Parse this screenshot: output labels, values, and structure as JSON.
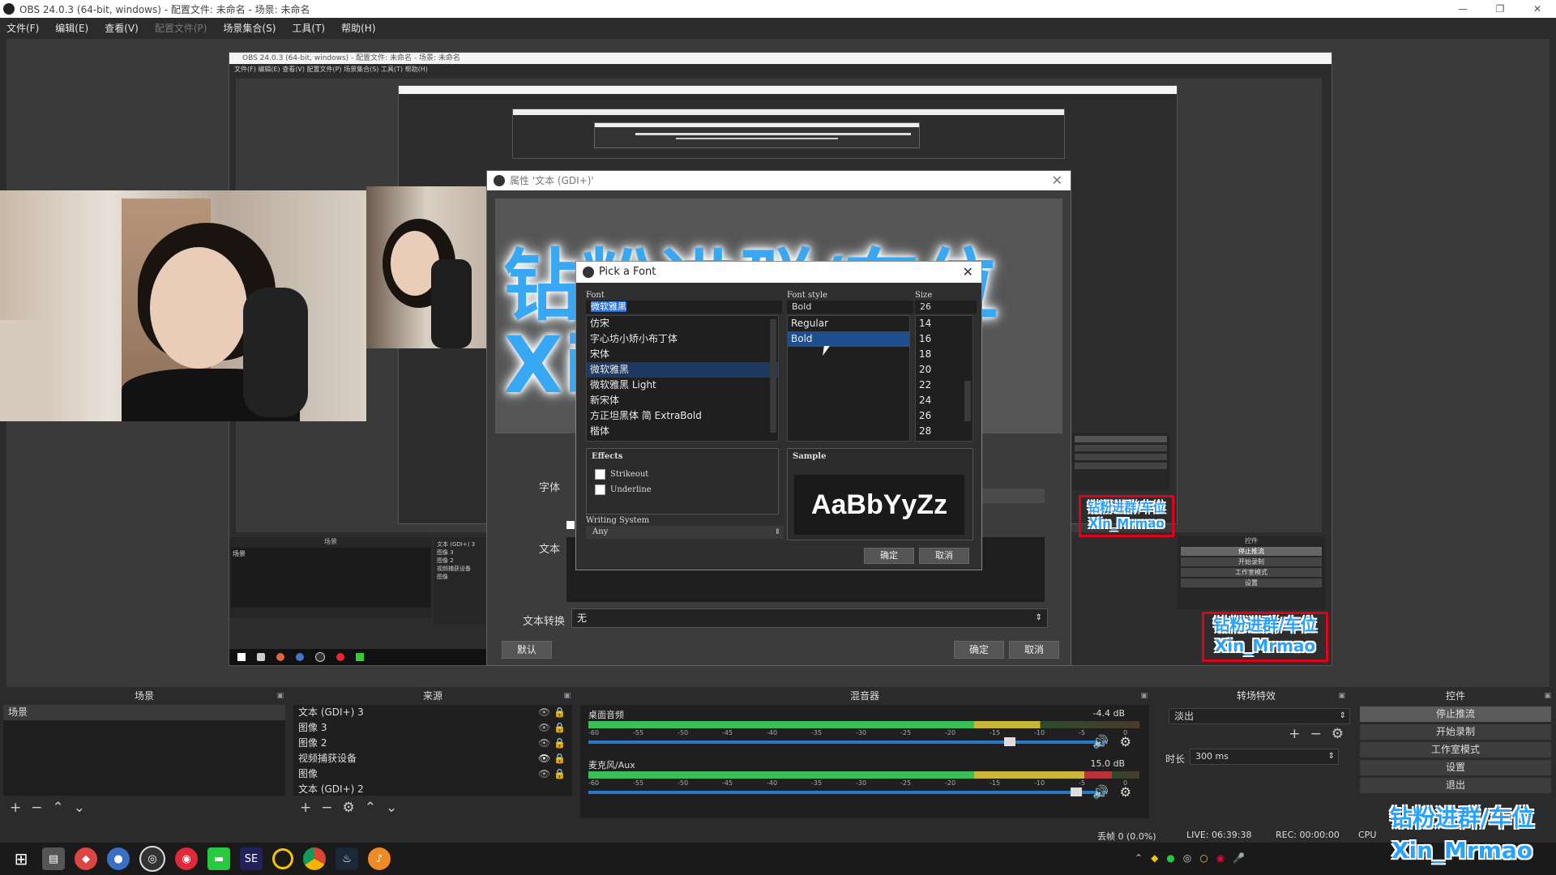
{
  "window": {
    "title": "OBS 24.0.3 (64-bit, windows) - 配置文件: 未命名 - 场景: 未命名",
    "min": "—",
    "max": "❐",
    "close": "✕"
  },
  "menu": [
    {
      "label": "文件(F)",
      "enabled": true
    },
    {
      "label": "编辑(E)",
      "enabled": true
    },
    {
      "label": "查看(V)",
      "enabled": true
    },
    {
      "label": "配置文件(P)",
      "enabled": false
    },
    {
      "label": "场景集合(S)",
      "enabled": true
    },
    {
      "label": "工具(T)",
      "enabled": true
    },
    {
      "label": "帮助(H)",
      "enabled": true
    }
  ],
  "nested": {
    "title": "OBS 24.0.3 (64-bit, windows) - 配置文件: 未命名 - 场景: 未命名",
    "menu": "文件(F)   编辑(E)   查看(V)   配置文件(P)   场景集合(S)   工具(T)   帮助(H)"
  },
  "properties": {
    "title": "属性 '文本 (GDI+)'",
    "font_label": "字体",
    "text_label": "文本",
    "transform_label": "文本转换",
    "transform_value": "无",
    "defaults_button": "默认",
    "ok_button": "确定",
    "cancel_button": "取消",
    "preview_line1": "钻粉进群/车位",
    "preview_line2": "Xin"
  },
  "font_dialog": {
    "title": "Pick a Font",
    "font_label": "Font",
    "style_label": "Font style",
    "size_label": "Size",
    "font_input": "微软雅黑",
    "style_input": "Bold",
    "size_input": "26",
    "fonts": [
      "仿宋",
      "字心坊小矫小布丁体",
      "宋体",
      "微软雅黑",
      "微软雅黑 Light",
      "新宋体",
      "方正坦黑体 简 ExtraBold",
      "楷体"
    ],
    "selected_font": "微软雅黑",
    "styles": [
      "Regular",
      "Bold"
    ],
    "selected_style": "Bold",
    "sizes": [
      "14",
      "16",
      "18",
      "20",
      "22",
      "24",
      "26",
      "28"
    ],
    "effects_label": "Effects",
    "strikeout": "Strikeout",
    "underline": "Underline",
    "writing_label": "Writing System",
    "writing_value": "Any",
    "sample_label": "Sample",
    "sample_text": "AaBbYyZz",
    "ok": "确定",
    "cancel": "取消"
  },
  "docks": {
    "scenes": {
      "title": "场景",
      "items": [
        "场景"
      ]
    },
    "sources": {
      "title": "来源",
      "items": [
        "文本 (GDI+) 3",
        "图像 3",
        "图像 2",
        "视频捕获设备",
        "图像",
        "文本 (GDI+) 2"
      ]
    },
    "mixer": {
      "title": "混音器",
      "channels": [
        {
          "name": "桌面音频",
          "db": "-4.4 dB",
          "level": 0.82
        },
        {
          "name": "麦克风/Aux",
          "db": "15.0 dB",
          "level": 0.95
        }
      ],
      "ticks": [
        "-60",
        "-55",
        "-50",
        "-45",
        "-40",
        "-35",
        "-30",
        "-25",
        "-20",
        "-15",
        "-10",
        "-5",
        "0"
      ]
    },
    "transitions": {
      "title": "转场特效",
      "value": "淡出",
      "duration_label": "时长",
      "duration_value": "300 ms"
    },
    "controls": {
      "title": "控件",
      "buttons": [
        "停止推流",
        "开始录制",
        "工作室模式",
        "设置",
        "退出"
      ]
    }
  },
  "status": {
    "dropped": "丢帧 0 (0.0%)",
    "live": "LIVE: 06:39:38",
    "rec": "REC: 00:00:00",
    "cpu": "CPU"
  },
  "watermark": {
    "line1": "钻粉进群/车位",
    "line2": "Xin_Mrmao"
  },
  "colors": {
    "accent": "#2aa0ff",
    "red": "#e0001a",
    "meter_green": "#3bbd5a",
    "meter_yellow": "#c9b53a",
    "slider": "#2a78c8"
  }
}
